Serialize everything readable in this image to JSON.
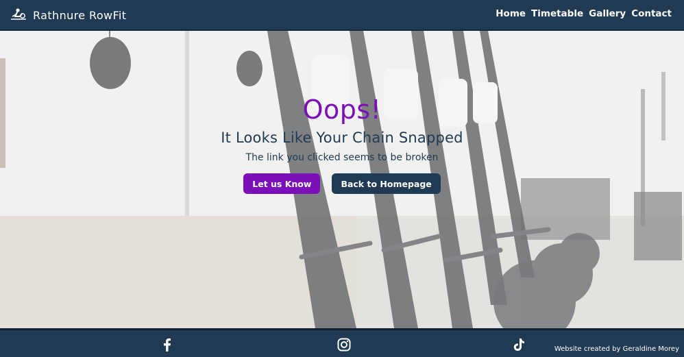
{
  "site": {
    "brand_name": "Rathnure RowFit",
    "logo_icon": "rower-icon"
  },
  "nav": {
    "items": [
      {
        "label": "Home"
      },
      {
        "label": "Timetable"
      },
      {
        "label": "Gallery"
      },
      {
        "label": "Contact"
      }
    ]
  },
  "error": {
    "heading": "Oops!",
    "subheading": "It Looks Like Your Chain Snapped",
    "message": "The link you clicked seems to be broken"
  },
  "actions": {
    "report_label": "Let us Know",
    "home_label": "Back to Homepage"
  },
  "footer": {
    "socials": [
      {
        "icon": "facebook-icon"
      },
      {
        "icon": "instagram-icon"
      },
      {
        "icon": "tiktok-icon"
      }
    ],
    "credit": "Website created by Geraldine Morey"
  },
  "colors": {
    "navy": "#1f3a52",
    "purple": "#7b0fb8",
    "white": "#ffffff"
  }
}
